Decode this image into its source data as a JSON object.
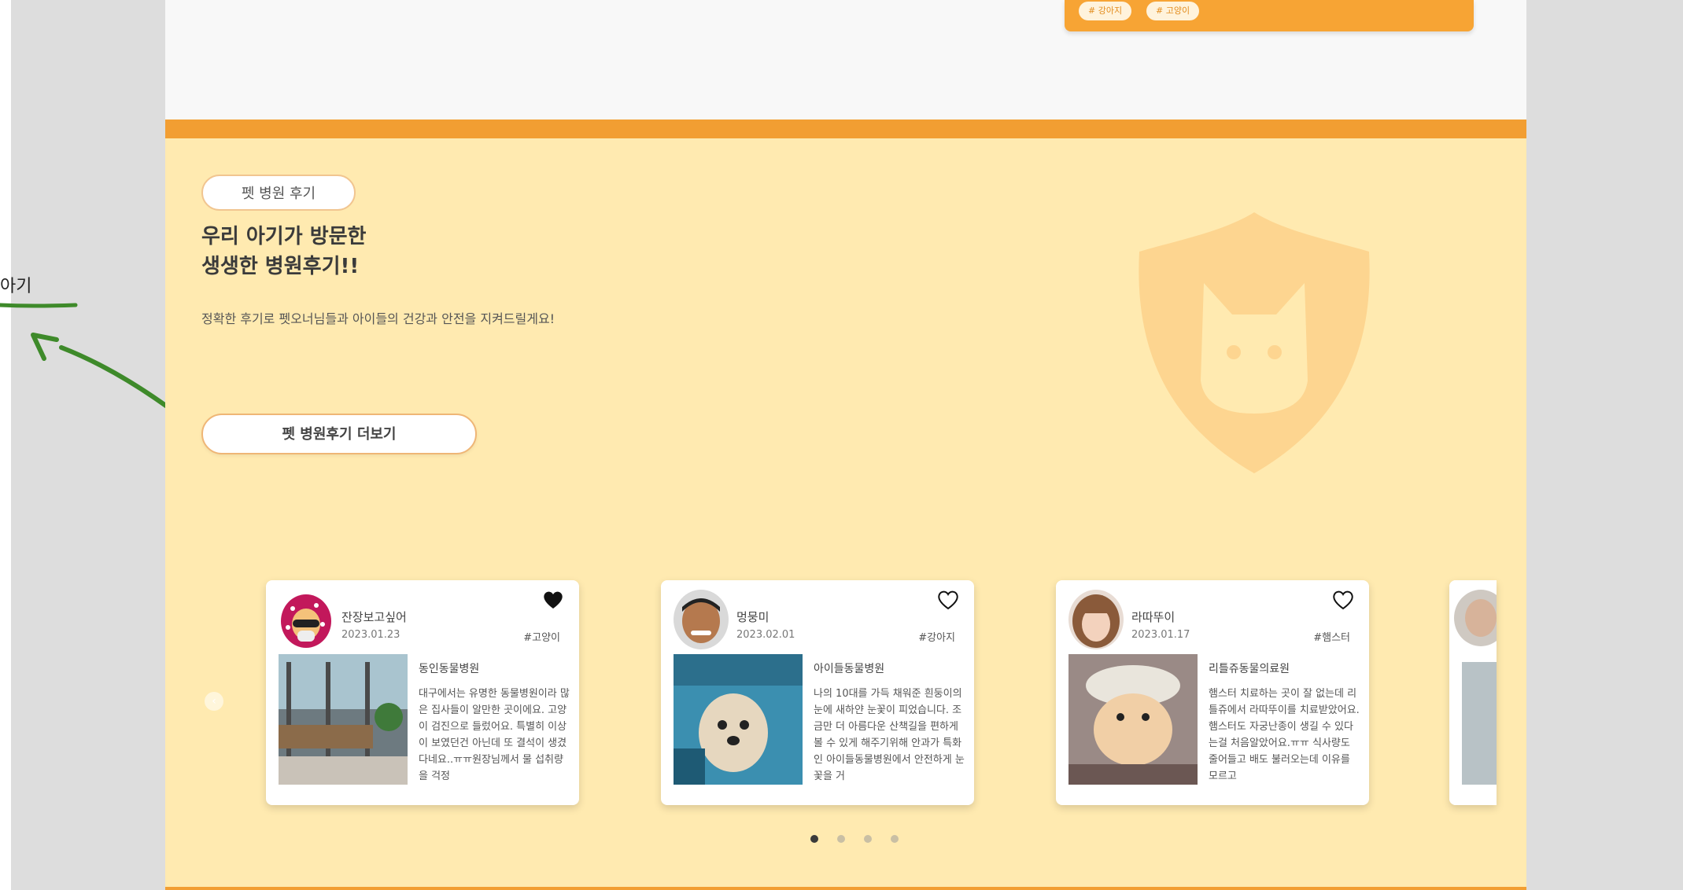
{
  "top_card": {
    "tags": [
      "# 강아지",
      "# 고양이"
    ]
  },
  "section": {
    "label": "펫 병원 후기",
    "title_line1": "우리 아기가 방문한",
    "title_line2": "생생한 병원후기!!",
    "description": "정확한 후기로 펫오너님들과 아이들의 건강과 안전을 지켜드릴게요!",
    "more_button": "펫 병원후기 더보기"
  },
  "annotation": {
    "text": "아기"
  },
  "colors": {
    "orange": "#f29e32",
    "yellow_bg": "#ffeab0",
    "shield": "#fdd590",
    "accent": "#f7a434"
  },
  "reviews": [
    {
      "username": "잔장보고싶어",
      "date": "2023.01.23",
      "tag": "#고양이",
      "liked": true,
      "hospital": "동인동물병원",
      "text": "대구에서는 유명한 동물병원이라 많은 집사들이 알만한 곳이에요. 고양이 검진으로 들렀어요. 특별히 이상이 보였던건 아닌데 또 결석이 생겼다네요..ㅠㅠ원장님께서 물 섭취량을 걱정"
    },
    {
      "username": "멍뭉미",
      "date": "2023.02.01",
      "tag": "#강아지",
      "liked": false,
      "hospital": "아이들동물병원",
      "text": "나의 10대를 가득 채워준 흰둥이의 눈에 새하얀 눈꽃이 피었습니다. 조금만 더 아름다운 산책길을 편하게 볼 수 있게 해주기위해 안과가 특화인 아이들동물병원에서 안전하게 눈꽃을 거"
    },
    {
      "username": "라따뚜이",
      "date": "2023.01.17",
      "tag": "#햄스터",
      "liked": false,
      "hospital": "리틀쥬동물의료원",
      "text": "햄스터 치료하는 곳이 잘 없는데 리틀쥬에서 라따뚜이를 치료받았어요. 햄스터도 자궁난종이 생길 수 있다는걸 처음알았어요.ㅠㅠ 식사량도 줄어들고 배도 불러오는데 이유를 모르고"
    }
  ],
  "pagination": {
    "count": 4,
    "active": 1
  }
}
